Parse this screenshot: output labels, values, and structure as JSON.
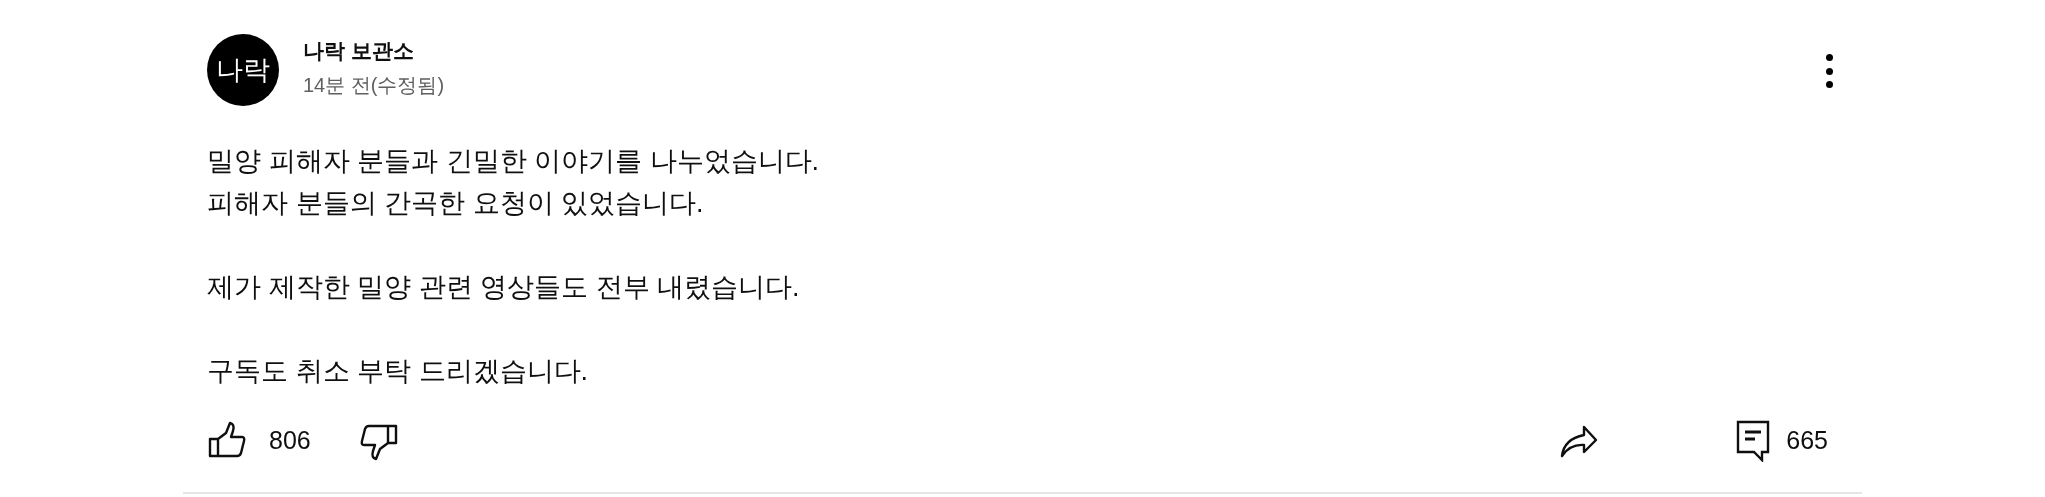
{
  "post": {
    "avatar_text": "나락",
    "author": "나락 보관소",
    "time": "14분 전(수정됨)",
    "paragraphs": [
      [
        "밀양 피해자 분들과 긴밀한 이야기를 나누었습니다.",
        "피해자 분들의 간곡한 요청이 있었습니다."
      ],
      [
        "제가 제작한 밀양 관련 영상들도 전부 내렸습니다."
      ],
      [
        "구독도 취소 부탁 드리겠습니다."
      ]
    ],
    "likes": "806",
    "comments": "665"
  }
}
